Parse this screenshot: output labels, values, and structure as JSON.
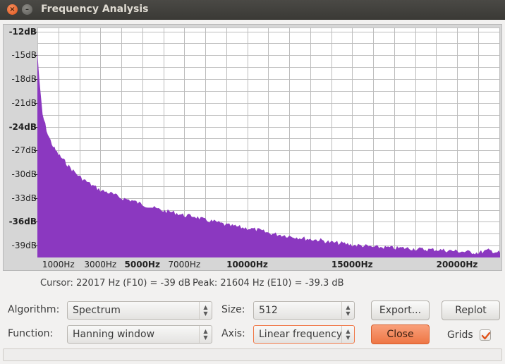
{
  "window": {
    "title": "Frequency Analysis",
    "close_glyph": "×",
    "minimize_glyph": "–"
  },
  "plot": {
    "y_labels": [
      {
        "text": "-12dB",
        "value": -12,
        "bold": true
      },
      {
        "text": "-15dB",
        "value": -15,
        "bold": false
      },
      {
        "text": "-18dB",
        "value": -18,
        "bold": false
      },
      {
        "text": "-21dB",
        "value": -21,
        "bold": false
      },
      {
        "text": "-24dB",
        "value": -24,
        "bold": true
      },
      {
        "text": "-27dB",
        "value": -27,
        "bold": false
      },
      {
        "text": "-30dB",
        "value": -30,
        "bold": false
      },
      {
        "text": "-33dB",
        "value": -33,
        "bold": false
      },
      {
        "text": "-36dB",
        "value": -36,
        "bold": true
      },
      {
        "text": "-39dB",
        "value": -39,
        "bold": false
      }
    ],
    "x_labels": [
      {
        "text": "1000Hz",
        "value": 1000,
        "bold": false
      },
      {
        "text": "3000Hz",
        "value": 3000,
        "bold": false
      },
      {
        "text": "5000Hz",
        "value": 5000,
        "bold": true
      },
      {
        "text": "7000Hz",
        "value": 7000,
        "bold": false
      },
      {
        "text": "10000Hz",
        "value": 10000,
        "bold": true
      },
      {
        "text": "15000Hz",
        "value": 15000,
        "bold": true
      },
      {
        "text": "20000Hz",
        "value": 20000,
        "bold": true
      }
    ],
    "fill_color": "#8b38c0",
    "grid_color": "#bcbcbc",
    "grids": true
  },
  "chart_data": {
    "type": "area",
    "xlim": [
      0,
      22050
    ],
    "ylim": [
      -40.5,
      -11.5
    ],
    "grid": true,
    "x": [
      0,
      100,
      250,
      500,
      750,
      1000,
      1250,
      1500,
      2000,
      2500,
      3000,
      3500,
      4000,
      4500,
      5000,
      5500,
      6000,
      6500,
      7000,
      7500,
      8000,
      8500,
      9000,
      9500,
      10000,
      10500,
      11000,
      11500,
      12000,
      12500,
      13000,
      13500,
      14000,
      14500,
      15000,
      15500,
      16000,
      16500,
      17000,
      17500,
      18000,
      18500,
      19000,
      19500,
      20000,
      20500,
      21000,
      21500,
      22050
    ],
    "values": [
      -14.5,
      -18.5,
      -22.5,
      -25,
      -26.5,
      -27.5,
      -28.2,
      -29,
      -30.3,
      -31.2,
      -32,
      -32.4,
      -33,
      -33.3,
      -33.8,
      -34.2,
      -34.6,
      -34.8,
      -35.2,
      -35.3,
      -35.8,
      -36,
      -36.4,
      -36.6,
      -36.8,
      -37,
      -37.4,
      -37.6,
      -37.8,
      -38,
      -38.2,
      -38.3,
      -38.6,
      -38.7,
      -38.9,
      -39,
      -39.2,
      -39.2,
      -39.3,
      -39.3,
      -39.4,
      -39.5,
      -39.5,
      -39.6,
      -39.7,
      -39.8,
      -39.9,
      -39.6,
      -39.9
    ]
  },
  "status": {
    "cursor": "Cursor: 22017 Hz (F10) = -39 dB",
    "peak": "Peak: 21604 Hz (E10) = -39.3 dB"
  },
  "controls": {
    "algorithm_label": "Algorithm:",
    "algorithm_value": "Spectrum",
    "function_label": "Function:",
    "function_value": "Hanning window",
    "size_label": "Size:",
    "size_value": "512",
    "axis_label": "Axis:",
    "axis_value": "Linear frequency",
    "export_label": "Export...",
    "replot_label": "Replot",
    "close_label": "Close",
    "grids_label": "Grids",
    "grids_checked": true
  }
}
